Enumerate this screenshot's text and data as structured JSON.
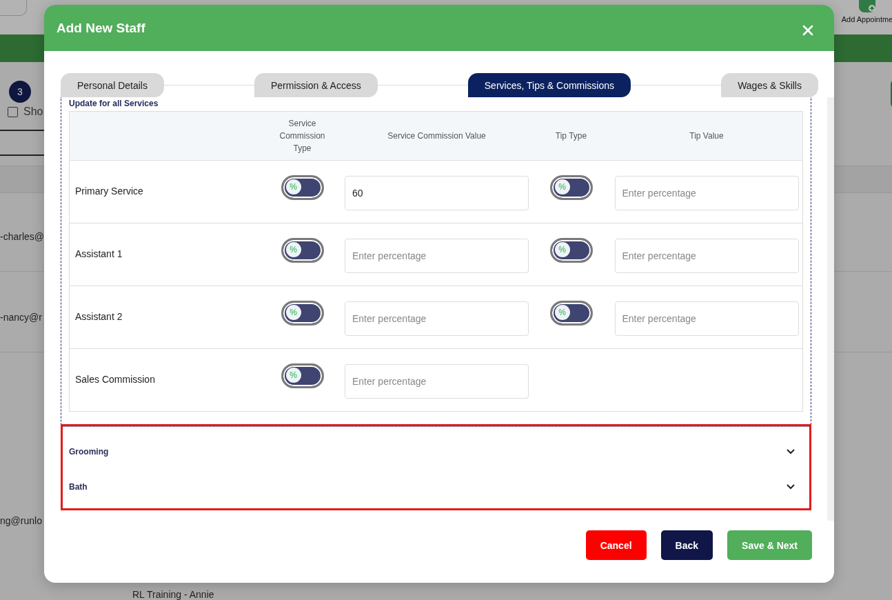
{
  "background": {
    "badge": "3",
    "checkbox": {
      "label": "Sho",
      "checked": false
    },
    "emails": [
      "-charles@",
      "-nancy@r",
      "ng@runlo"
    ],
    "trainer": "RL Training - Annie",
    "toolbar_label": "Add Appointme"
  },
  "modal": {
    "title": "Add New Staff",
    "tabs": [
      {
        "label": "Personal Details",
        "selected": false
      },
      {
        "label": "Permission & Access",
        "selected": false
      },
      {
        "label": "Services, Tips & Commissions",
        "selected": true
      },
      {
        "label": "Wages & Skills",
        "selected": false
      }
    ],
    "section_title": "Update for all Services",
    "columns": [
      "Service Commission Type",
      "Service Commission Value",
      "Tip Type",
      "Tip Value"
    ],
    "rows": [
      {
        "label": "Primary Service",
        "commission_type": {
          "unit": "%",
          "on": false
        },
        "commission_value": {
          "value": "60"
        },
        "tip_type": {
          "unit": "%",
          "on": false
        },
        "tip_value": {
          "placeholder": "Enter percentage"
        }
      },
      {
        "label": "Assistant 1",
        "commission_type": {
          "unit": "%",
          "on": false
        },
        "commission_value": {
          "placeholder": "Enter percentage"
        },
        "tip_type": {
          "unit": "%",
          "on": false
        },
        "tip_value": {
          "placeholder": "Enter percentage"
        }
      },
      {
        "label": "Assistant 2",
        "commission_type": {
          "unit": "%",
          "on": false
        },
        "commission_value": {
          "placeholder": "Enter percentage"
        },
        "tip_type": {
          "unit": "%",
          "on": false
        },
        "tip_value": {
          "placeholder": "Enter percentage"
        }
      },
      {
        "label": "Sales Commission",
        "commission_type": {
          "unit": "%",
          "on": false
        },
        "commission_value": {
          "placeholder": "Enter percentage"
        }
      }
    ],
    "categories_highlighted": true,
    "categories": [
      {
        "label": "Grooming",
        "expanded": false
      },
      {
        "label": "Bath",
        "expanded": false
      }
    ],
    "buttons": [
      {
        "label": "Cancel",
        "kind": "danger"
      },
      {
        "label": "Back",
        "kind": "secondary"
      },
      {
        "label": "Save & Next",
        "kind": "primary"
      }
    ]
  }
}
